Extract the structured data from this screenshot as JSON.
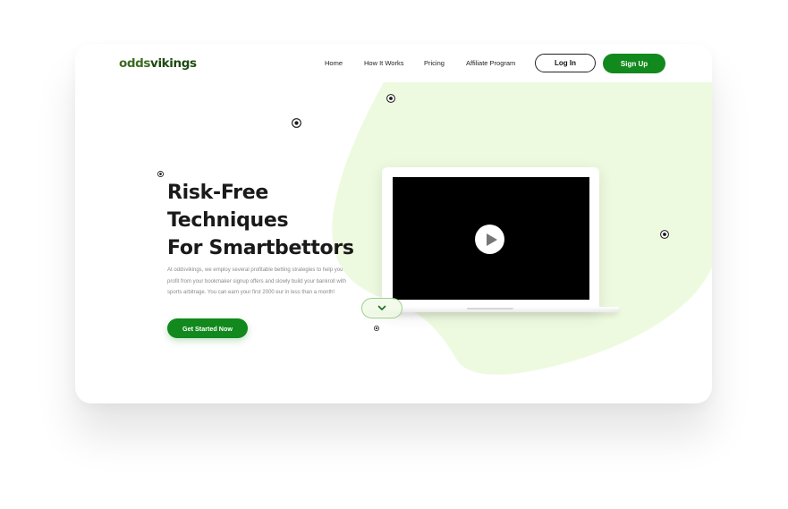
{
  "brand": {
    "logo_main": "odds",
    "logo_accent": "vikings"
  },
  "nav": {
    "home": "Home",
    "how_it_works": "How It Works",
    "pricing": "Pricing",
    "affiliate": "Affiliate Program",
    "login": "Log In",
    "signup": "Sign Up"
  },
  "hero": {
    "headline_line1": "Risk-Free",
    "headline_line2": "Techniques",
    "headline_line3": "For Smartbettors",
    "description": "At oddsvikings, we employ several profitable betting strategies to help you profit from your bookmaker signup offers and slowly build your bankroll with sports arbitrage. You can earn your first 2000 eur in less than a month!",
    "cta": "Get Started Now"
  },
  "colors": {
    "brand_green": "#12891d",
    "logo_green": "#3d6c22",
    "blob_green": "#eefadf",
    "text_dark": "#1a1a1a",
    "text_muted": "#8a8a8a"
  },
  "icons": {
    "play": "play-icon",
    "scroll": "chevron-down-icon",
    "decoration": "soccer-ball-icon"
  }
}
